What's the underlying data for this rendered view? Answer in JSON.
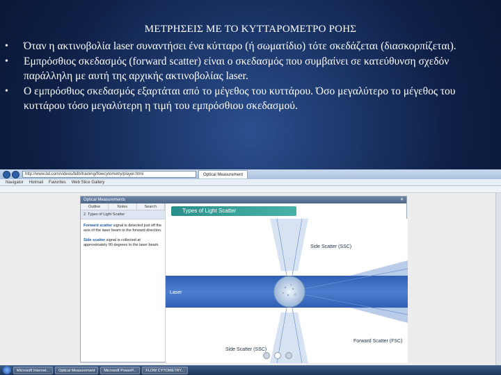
{
  "slide": {
    "title": "ΜΕΤΡΗΣΕΙΣ ΜΕ ΤΟ ΚΥΤΤΑΡΟΜΕΤΡΟ ΡΟΗΣ",
    "bullets": [
      "Όταν η ακτινοβολία laser συναντήσει ένα κύτταρο (ή σωματίδιο) τότε σκεδάζεται (διασκορπίζεται).",
      "Εμπρόσθιος σκεδασμός (forward scatter) είναι ο σκεδασμός που συμβαίνει σε κατεύθυνση σχεδόν παράλληλη με αυτή της αρχικής ακτινοβολίας laser.",
      "Ο εμπρόσθιος σκεδασμός εξαρτάται από το μέγεθος του κυττάρου. Όσο μεγαλύτερο το μέγεθος του κυττάρου τόσο μεγαλύτερη η τιμή του εμπρόσθιου σκεδασμού."
    ]
  },
  "browser": {
    "url": "http://www.bd.com/videos/bdb/training/flowcytometry/player.html",
    "tabs": [
      "Optical Measurement"
    ],
    "bookmarks": [
      "Navigator",
      "Hotmail",
      "Favorites",
      "Web Slice Gallery"
    ],
    "player": {
      "title": "Optical Measurements",
      "nav_tabs": [
        "Outline",
        "Notes",
        "Search"
      ],
      "lesson": "2. Types of Light Scatter",
      "paragraphs": [
        {
          "term": "Forward scatter",
          "rest": " signal is detected just off the axis of the laser beam in the forward direction."
        },
        {
          "term": "Side scatter",
          "rest": " signal is collected at approximately 90 degrees to the laser beam."
        }
      ],
      "banner": "Types of Light Scatter",
      "labels": {
        "laser": "Laser",
        "ssc_top": "Side Scatter (SSC)",
        "ssc_bottom": "Side Scatter (SSC)",
        "fsc": "Forward Scatter (FSC)"
      }
    },
    "taskbar": [
      "Microsoft Internet...",
      "Optical Measurement",
      "Microsoft PowerP...",
      "FLOW CYTOMETRY..."
    ]
  }
}
